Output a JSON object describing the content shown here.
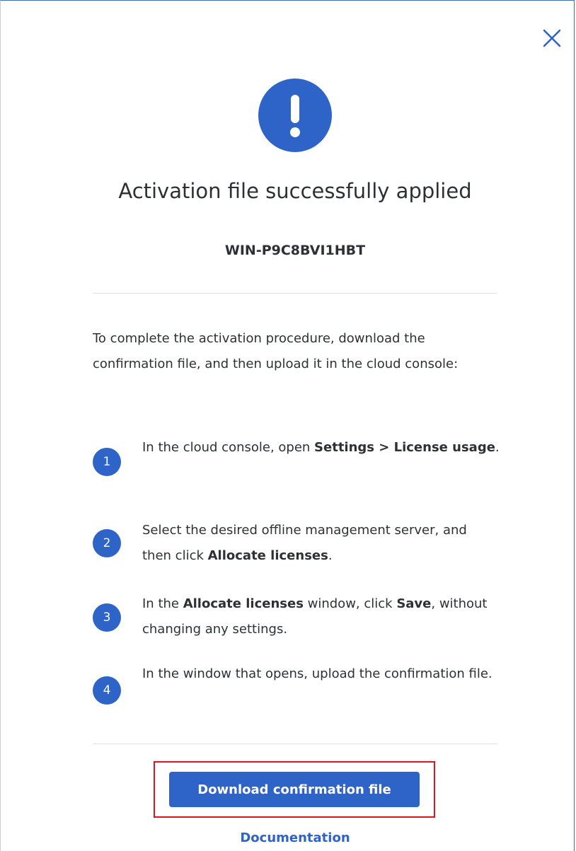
{
  "dialog": {
    "title": "Activation file successfully applied",
    "machine_name": "WIN-P9C8BVI1HBT",
    "intro": "To complete the activation procedure, download the confirmation file, and then upload it in the cloud console:",
    "steps": [
      {
        "number": "1",
        "parts": [
          {
            "text": "In the cloud console, open ",
            "bold": false
          },
          {
            "text": "Settings > License usage",
            "bold": true
          },
          {
            "text": ".",
            "bold": false
          }
        ]
      },
      {
        "number": "2",
        "parts": [
          {
            "text": "Select the desired offline management server, and then click ",
            "bold": false
          },
          {
            "text": "Allocate licenses",
            "bold": true
          },
          {
            "text": ".",
            "bold": false
          }
        ]
      },
      {
        "number": "3",
        "parts": [
          {
            "text": "In the ",
            "bold": false
          },
          {
            "text": "Allocate licenses",
            "bold": true
          },
          {
            "text": " window, click ",
            "bold": false
          },
          {
            "text": "Save",
            "bold": true
          },
          {
            "text": ", without changing any settings.",
            "bold": false
          }
        ]
      },
      {
        "number": "4",
        "parts": [
          {
            "text": "In the window that opens, upload the confirmation file.",
            "bold": false
          }
        ]
      }
    ],
    "download_button_label": "Download confirmation file",
    "documentation_link": "Documentation",
    "icons": {
      "close": "close-icon",
      "alert": "exclamation-icon"
    },
    "colors": {
      "accent": "#2e63c7",
      "highlight": "#e0141e",
      "text": "#2d3135"
    }
  }
}
